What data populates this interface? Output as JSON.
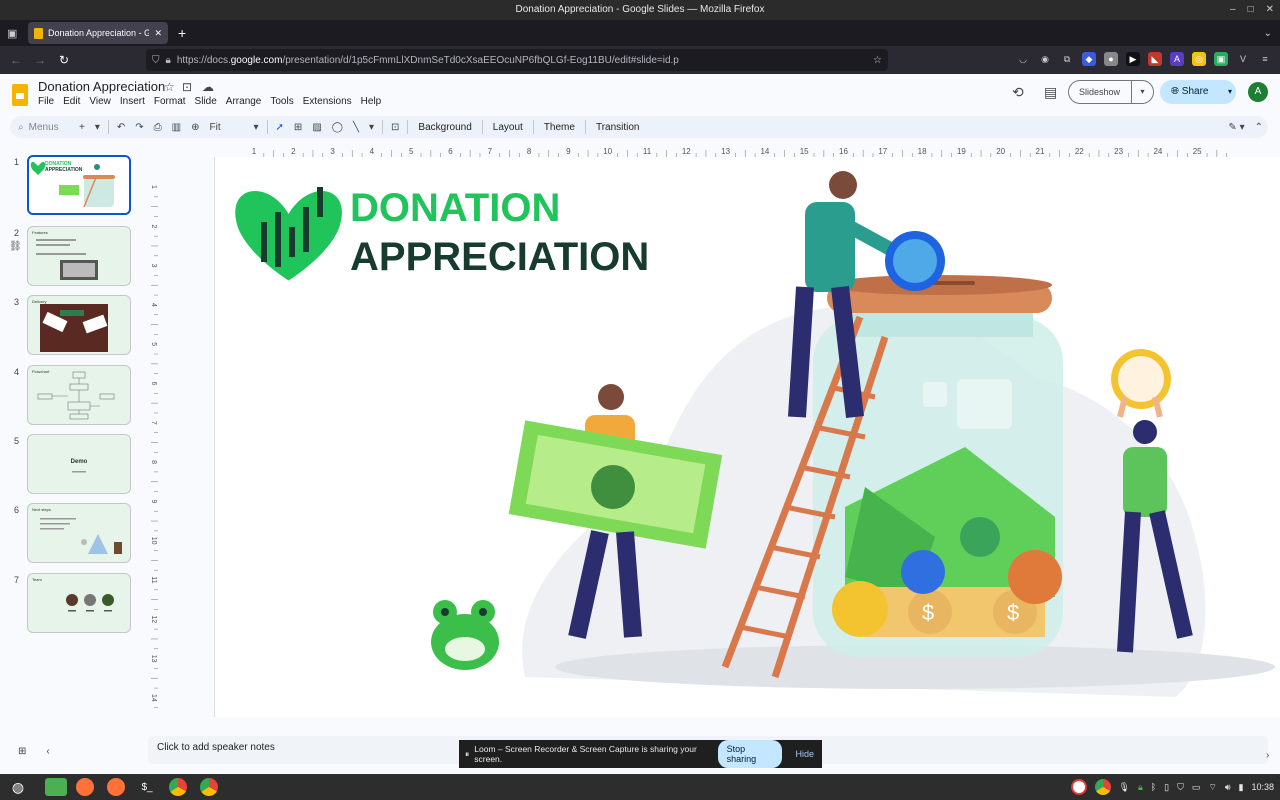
{
  "window": {
    "title": "Donation Appreciation - Google Slides — Mozilla Firefox"
  },
  "browser": {
    "tab_title": "Donation Appreciation - Go",
    "url_prefix": "https://docs.",
    "url_domain": "google.com",
    "url_suffix": "/presentation/d/1p5cFmmLlXDnmSeTd0cXsaEEOcuNP6fbQLGf-Eog11BU/edit#slide=id.p"
  },
  "doc": {
    "title": "Donation Appreciation",
    "menus": [
      "File",
      "Edit",
      "View",
      "Insert",
      "Format",
      "Slide",
      "Arrange",
      "Tools",
      "Extensions",
      "Help"
    ],
    "slideshow_label": "Slideshow",
    "share_label": "Share",
    "avatar_letter": "A"
  },
  "toolbar": {
    "search_placeholder": "Menus",
    "zoom_label": "Fit",
    "background_label": "Background",
    "layout_label": "Layout",
    "theme_label": "Theme",
    "transition_label": "Transition"
  },
  "ruler": {
    "h_ticks": [
      "1",
      "2",
      "3",
      "4",
      "5",
      "6",
      "7",
      "8",
      "9",
      "10",
      "11",
      "12",
      "13",
      "14",
      "15",
      "16",
      "17",
      "18",
      "19",
      "20",
      "21",
      "22",
      "23",
      "24",
      "25"
    ],
    "v_ticks": [
      "1",
      "2",
      "3",
      "4",
      "5",
      "6",
      "7",
      "8",
      "9",
      "10",
      "11",
      "12",
      "13",
      "14"
    ]
  },
  "slides": [
    {
      "number": "1",
      "title": "DONATION APPRECIATION"
    },
    {
      "number": "2",
      "title": "Features"
    },
    {
      "number": "3",
      "title": "Delivery"
    },
    {
      "number": "4",
      "title": "Flowchart"
    },
    {
      "number": "5",
      "title": "Demo"
    },
    {
      "number": "6",
      "title": "Next steps"
    },
    {
      "number": "7",
      "title": "Team"
    }
  ],
  "slide_main": {
    "title_line1": "DONATION",
    "title_line2": "APPRECIATION"
  },
  "notes": {
    "placeholder": "Click to add speaker notes"
  },
  "loom": {
    "message": "Loom – Screen Recorder & Screen Capture is sharing your screen.",
    "stop": "Stop sharing",
    "hide": "Hide"
  },
  "taskbar": {
    "clock": "10:38"
  },
  "colors": {
    "accent": "#0b57d0",
    "slide_green": "#21c45a",
    "slide_dark": "#173b2f",
    "jar_lid": "#d98a5a",
    "money_green": "#7ed957"
  }
}
